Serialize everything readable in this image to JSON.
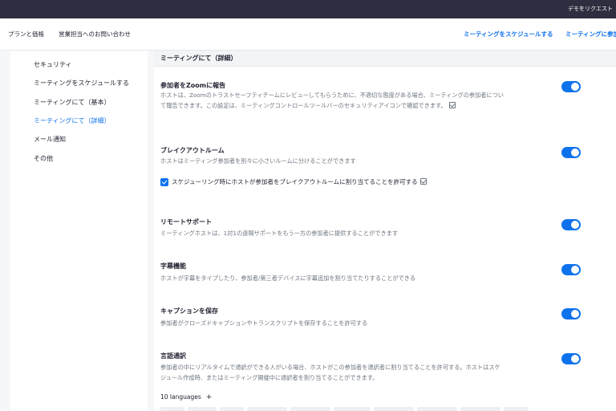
{
  "topbar": {
    "demo_label": "デモをリクエスト"
  },
  "nav": {
    "left": [
      "プランと価格",
      "営業担当へのお問い合わせ"
    ],
    "right": [
      "ミーティングをスケジュールする",
      "ミーティングに参加"
    ]
  },
  "sidebar": {
    "items": [
      {
        "label": "セキュリティ"
      },
      {
        "label": "ミーティングをスケジュールする"
      },
      {
        "label": "ミーティングにて（基本）"
      },
      {
        "label": "ミーティングにて（詳細）"
      },
      {
        "label": "メール通知"
      },
      {
        "label": "その他"
      }
    ]
  },
  "section": {
    "title": "ミーティングにて（詳細）"
  },
  "settings": [
    {
      "title": "参加者をZoomに報告",
      "desc": "ホストは、Zoomのトラストセーフティチームにレビューしてもらうために、不適切な態度がある場合、ミーティングの参加者について報告できます。この設定は、ミーティングコントロールツールバーのセキュリティアイコンで確認できます。",
      "enabled": true
    },
    {
      "title": "ブレイクアウトルーム",
      "desc": "ホストはミーティング参加者を別々に小さいルームに分けることができます",
      "enabled": true
    },
    {
      "title": "リモートサポート",
      "desc": "ミーティングホストは、1対1の遠隔サポートをもう一方の参加者に提供することができます",
      "enabled": true
    },
    {
      "title": "字幕機能",
      "desc": "ホストが字幕をタイプしたり、参加者/第三者デバイスに字幕追加を割り当てたりすることができる",
      "enabled": true
    },
    {
      "title": "キャプションを保存",
      "desc": "参加者がクローズドキャプションやトランスクリプトを保存することを許可する",
      "enabled": true
    },
    {
      "title": "言語通訳",
      "desc": "参加者の中にリアルタイムで通訳ができる人がいる場合、ホストがこの参加者を通訳者に割り当てることを許可する。ホストはスケジュール作成時、またはミーティング開催中に通訳者を割り当てることができます。",
      "enabled": true
    }
  ],
  "breakout_option": {
    "label": "スケジューリング時にホストが参加者をブレイクアウトルームに割り当てることを許可する",
    "checked": true
  },
  "languages": {
    "label": "10 languages",
    "add_symbol": "+"
  },
  "colors": {
    "accent": "#0e72ed",
    "topbar": "#2d2f40"
  },
  "icons": [
    "lock-icon",
    "checkmark-icon",
    "plus-icon"
  ]
}
